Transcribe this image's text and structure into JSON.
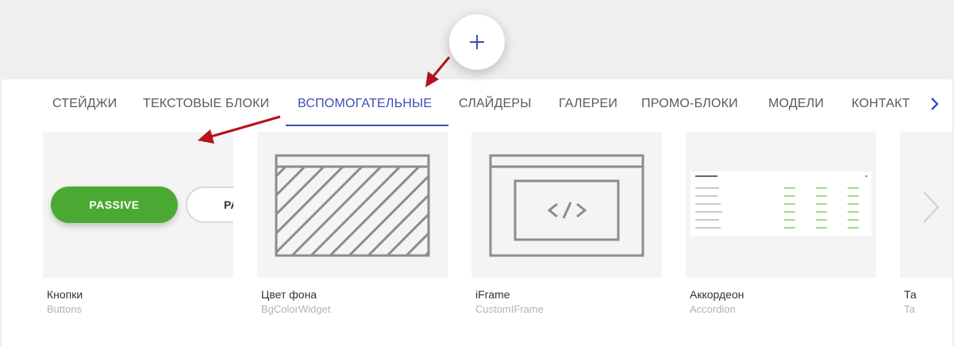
{
  "tabs": [
    {
      "label": "СТЕЙДЖИ",
      "active": false
    },
    {
      "label": "ТЕКСТОВЫЕ БЛОКИ",
      "active": false
    },
    {
      "label": "ВСПОМОГАТЕЛЬНЫЕ",
      "active": true
    },
    {
      "label": "СЛАЙДЕРЫ",
      "active": false
    },
    {
      "label": "ГАЛЕРЕИ",
      "active": false
    },
    {
      "label": "ПРОМО-БЛОКИ",
      "active": false
    },
    {
      "label": "МОДЕЛИ",
      "active": false
    },
    {
      "label": "КОНТАКТ",
      "active": false
    }
  ],
  "cards": [
    {
      "title": "Кнопки",
      "subtitle": "Buttons",
      "preview": {
        "primary_label": "PASSIVE",
        "secondary_label": "PA"
      }
    },
    {
      "title": "Цвет фона",
      "subtitle": "BgColorWidget"
    },
    {
      "title": "iFrame",
      "subtitle": "CustomIFrame"
    },
    {
      "title": "Аккордеон",
      "subtitle": "Accordion"
    },
    {
      "title": "Та",
      "subtitle": "Ta"
    }
  ],
  "colors": {
    "accent": "#3b4eb4",
    "green": "#4aa932",
    "annotation_arrow": "#b5121b"
  },
  "icons": {
    "add": "plus-icon",
    "tabs_next": "chevron-right-icon",
    "slider_next": "chevron-right-icon"
  }
}
